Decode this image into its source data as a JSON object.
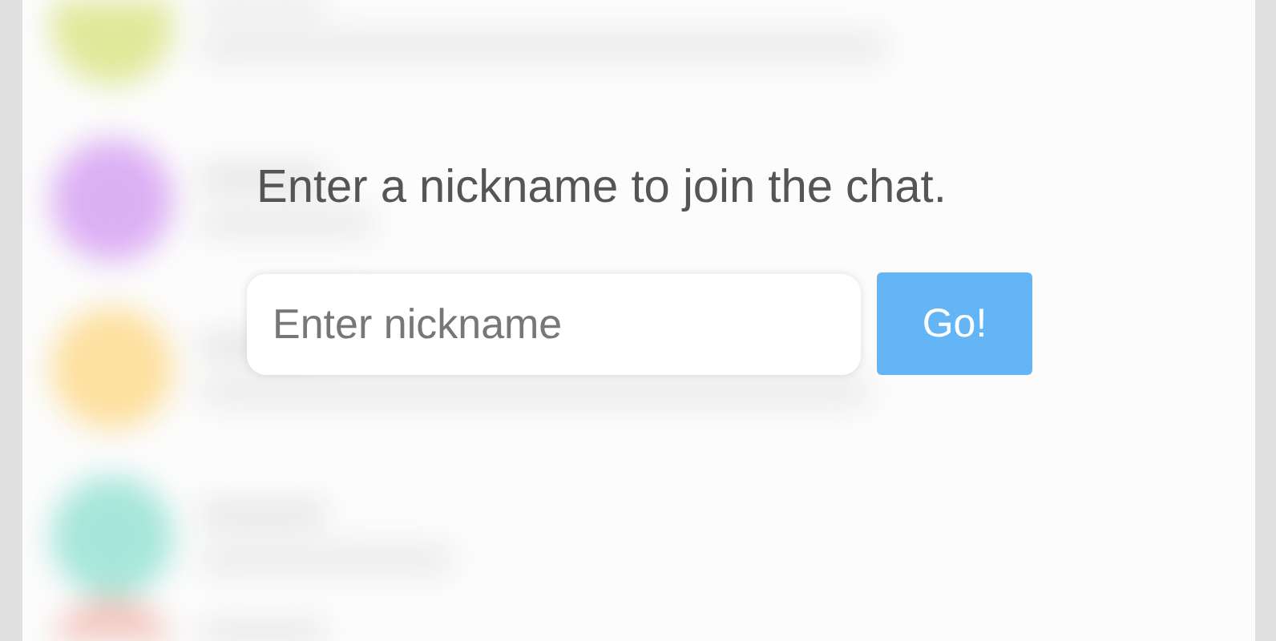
{
  "prompt": "Enter a nickname to join the chat.",
  "nickname_field": {
    "placeholder": "Enter nickname"
  },
  "submit_button": {
    "label": "Go!"
  }
}
